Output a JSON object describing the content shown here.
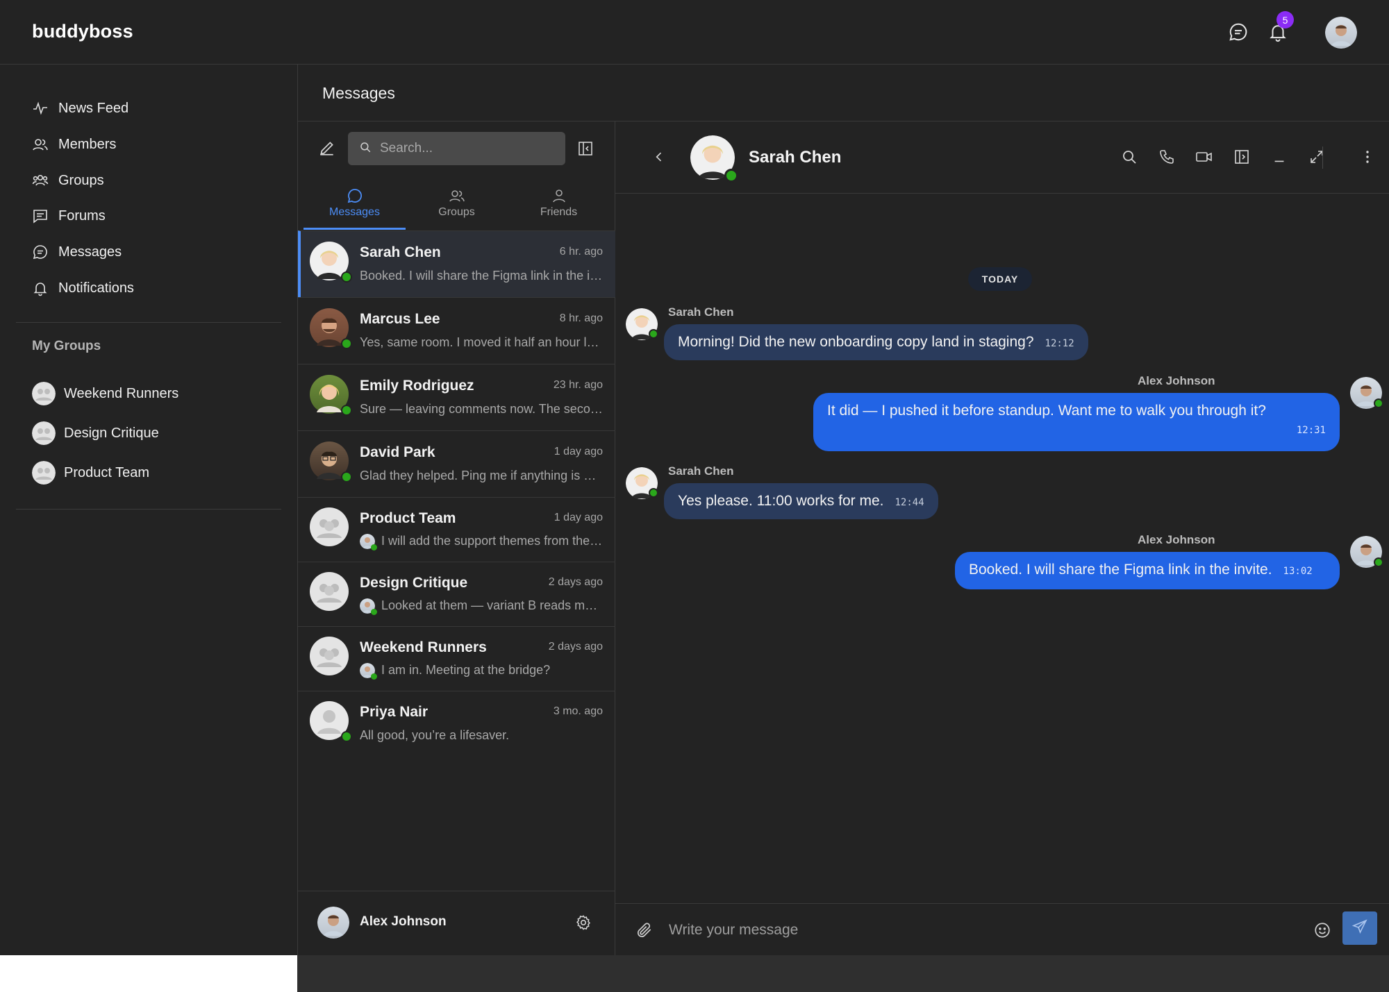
{
  "app": {
    "logo": "buddyboss",
    "notification_count": "5"
  },
  "sidebar": {
    "nav": [
      {
        "label": "News Feed",
        "icon": "activity-icon"
      },
      {
        "label": "Members",
        "icon": "members-icon"
      },
      {
        "label": "Groups",
        "icon": "groups-icon"
      },
      {
        "label": "Forums",
        "icon": "forums-icon"
      },
      {
        "label": "Messages",
        "icon": "messages-icon"
      },
      {
        "label": "Notifications",
        "icon": "bell-icon"
      }
    ],
    "my_groups_title": "My Groups",
    "groups": [
      {
        "label": "Weekend Runners"
      },
      {
        "label": "Design Critique"
      },
      {
        "label": "Product Team"
      }
    ]
  },
  "messages_page": {
    "title": "Messages",
    "search_placeholder": "Search...",
    "tabs": [
      {
        "label": "Messages",
        "icon": "chat-bubble-icon",
        "active": true
      },
      {
        "label": "Groups",
        "icon": "groups-icon",
        "active": false
      },
      {
        "label": "Friends",
        "icon": "user-icon",
        "active": false
      }
    ],
    "conversations": [
      {
        "name": "Sarah Chen",
        "time": "6 hr. ago",
        "preview": "Booked. I will share the Figma link in the invite."
      },
      {
        "name": "Marcus Lee",
        "time": "8 hr. ago",
        "preview": "Yes, same room. I moved it half an hour later."
      },
      {
        "name": "Emily Rodriguez",
        "time": "23 hr. ago",
        "preview": "Sure — leaving comments now. The second draft reads well."
      },
      {
        "name": "David Park",
        "time": "1 day ago",
        "preview": "Glad they helped. Ping me if anything is unclear."
      },
      {
        "name": "Product Team",
        "time": "1 day ago",
        "preview": "I will add the support themes from the last sprint."
      },
      {
        "name": "Design Critique",
        "time": "2 days ago",
        "preview": "Looked at them — variant B reads much clearer."
      },
      {
        "name": "Weekend Runners",
        "time": "2 days ago",
        "preview": "I am in. Meeting at the bridge?"
      },
      {
        "name": "Priya Nair",
        "time": "3 mo. ago",
        "preview": "All good, you’re a lifesaver."
      }
    ],
    "current_user": "Alex Johnson"
  },
  "chat": {
    "contact_name": "Sarah Chen",
    "day_label": "TODAY",
    "messages": [
      {
        "sender": "Sarah Chen",
        "text": "Morning! Did the new onboarding copy land in staging?",
        "time": "12:12"
      },
      {
        "sender": "Alex Johnson",
        "text": "It did — I pushed it before standup. Want me to walk you through it?",
        "time": "12:31"
      },
      {
        "sender": "Sarah Chen",
        "text": "Yes please. 11:00 works for me.",
        "time": "12:44"
      },
      {
        "sender": "Alex Johnson",
        "text": "Booked. I will share the Figma link in the invite.",
        "time": "13:02"
      }
    ],
    "composer_placeholder": "Write your message"
  },
  "colors": {
    "accent": "#4c8df6",
    "online": "#2aa71b",
    "badge": "#8b2cf5",
    "outgoing_bubble": "#2264e5",
    "incoming_bubble": "#2a3b5c"
  }
}
